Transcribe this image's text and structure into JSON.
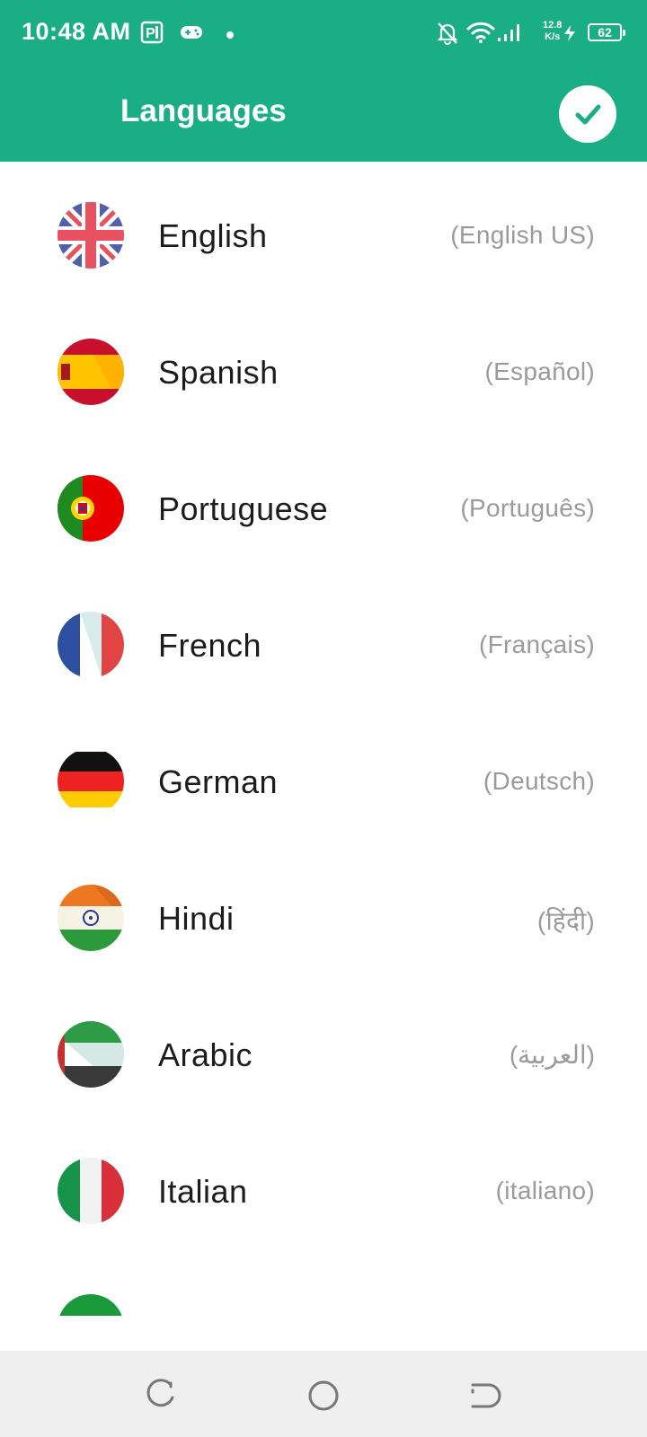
{
  "status_bar": {
    "time": "10:48 AM",
    "net_speed_value": "12.8",
    "net_speed_unit": "K/s",
    "battery": "62",
    "icons": [
      "app-p-icon",
      "gamepad-icon",
      "dot-icon",
      "bell-off-icon",
      "wifi-icon",
      "signal-icon",
      "charging-icon",
      "battery-icon"
    ]
  },
  "header": {
    "title": "Languages",
    "confirm_icon": "check-icon"
  },
  "languages": [
    {
      "name": "English",
      "native": "(English US)",
      "flag": "uk-flag-icon"
    },
    {
      "name": "Spanish",
      "native": "(Español)",
      "flag": "spain-flag-icon"
    },
    {
      "name": "Portuguese",
      "native": "(Português)",
      "flag": "portugal-flag-icon"
    },
    {
      "name": "French",
      "native": "(Français)",
      "flag": "france-flag-icon"
    },
    {
      "name": "German",
      "native": "(Deutsch)",
      "flag": "germany-flag-icon"
    },
    {
      "name": "Hindi",
      "native": "(हिंदी)",
      "flag": "india-flag-icon"
    },
    {
      "name": "Arabic",
      "native": "(العربية)",
      "flag": "uae-flag-icon"
    },
    {
      "name": "Italian",
      "native": "(italiano)",
      "flag": "italy-flag-icon"
    }
  ],
  "colors": {
    "accent": "#1aae84",
    "text_primary": "#1c1c1c",
    "text_secondary": "#9a9a9a",
    "nav_background": "#efefef"
  },
  "nav_bar": {
    "icons": [
      "recent-apps-icon",
      "home-icon",
      "back-icon"
    ]
  }
}
